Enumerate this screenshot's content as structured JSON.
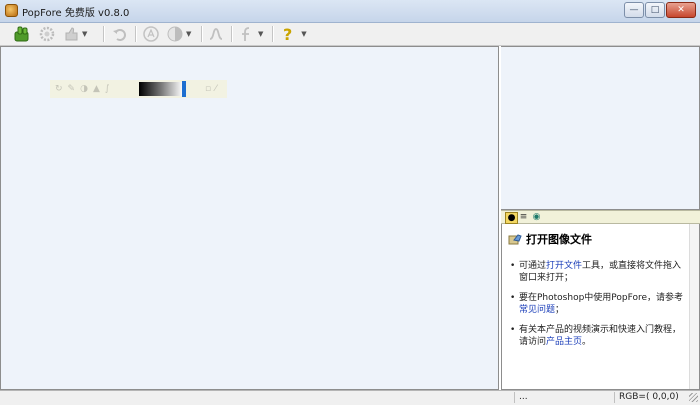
{
  "window": {
    "title": "PopFore 免费版 v0.8.0",
    "controls": {
      "minimize": "—",
      "maximize": "□",
      "close": "✕"
    }
  },
  "toolbar": {
    "icons": [
      "hand-thumbs-icon",
      "gear-icon",
      "thumb-icon",
      "undo-icon",
      "circle-a-icon",
      "half-circle-icon",
      "curve-icon",
      "f-stroke-icon",
      "help-icon"
    ],
    "help_glyph": "?"
  },
  "mini_toolbar": {
    "icons": [
      "rotate-icon",
      "brush-icon",
      "circle-icon",
      "cone-icon",
      "curve-icon",
      "wand-icon"
    ],
    "gradient_colors": [
      "#000000",
      "#777777",
      "#ffffff"
    ],
    "marker_color": "#1e6fd0"
  },
  "help_panel": {
    "title": "打开图像文件",
    "items": [
      {
        "prefix": "可通过",
        "link": "打开文件",
        "suffix": "工具，或直接将文件拖入窗口来打开；"
      },
      {
        "prefix": "要在Photoshop中使用PopFore，请参考",
        "link": "常见问题",
        "suffix": "；"
      },
      {
        "prefix": "有关本产品的视频演示和快速入门教程，请访问",
        "link": "产品主页",
        "suffix": "。"
      }
    ]
  },
  "statusbar": {
    "dots": "...",
    "rgb": "RGB=( 0,0,0)"
  },
  "colors": {
    "canvas_bg": "#eef3fa",
    "link": "#1a3db8",
    "toolbar_bg": "#f0f0f0"
  }
}
